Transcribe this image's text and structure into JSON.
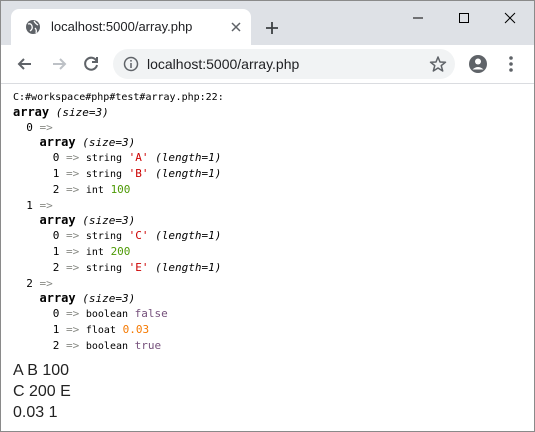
{
  "browser": {
    "tab_title": "localhost:5000/array.php",
    "url": "localhost:5000/array.php"
  },
  "dump": {
    "path": "C:#workspace#php#test#array.php:22:",
    "root_label": "array",
    "root_size": "(size=3)",
    "entries": [
      {
        "key": "0",
        "label": "array",
        "size": "(size=3)",
        "items": [
          {
            "key": "0",
            "type": "string",
            "value": "'A'",
            "extra": "(length=1)"
          },
          {
            "key": "1",
            "type": "string",
            "value": "'B'",
            "extra": "(length=1)"
          },
          {
            "key": "2",
            "type": "int",
            "value": "100",
            "extra": ""
          }
        ]
      },
      {
        "key": "1",
        "label": "array",
        "size": "(size=3)",
        "items": [
          {
            "key": "0",
            "type": "string",
            "value": "'C'",
            "extra": "(length=1)"
          },
          {
            "key": "1",
            "type": "int",
            "value": "200",
            "extra": ""
          },
          {
            "key": "2",
            "type": "string",
            "value": "'E'",
            "extra": "(length=1)"
          }
        ]
      },
      {
        "key": "2",
        "label": "array",
        "size": "(size=3)",
        "items": [
          {
            "key": "0",
            "type": "boolean",
            "value": "false",
            "extra": ""
          },
          {
            "key": "1",
            "type": "float",
            "value": "0.03",
            "extra": ""
          },
          {
            "key": "2",
            "type": "boolean",
            "value": "true",
            "extra": ""
          }
        ]
      }
    ]
  },
  "output_lines": [
    "A B 100",
    "C 200 E",
    "0.03 1"
  ],
  "colors": {
    "string": "#cc0000",
    "int": "#4e9a06",
    "boolean": "#75507b",
    "float": "#f57900",
    "arrow": "#888a85"
  },
  "icons": [
    "globe-icon",
    "close-icon",
    "plus-icon",
    "minimize-icon",
    "maximize-icon",
    "close-window-icon",
    "back-arrow-icon",
    "forward-arrow-icon",
    "reload-icon",
    "info-icon",
    "star-icon",
    "profile-icon",
    "menu-dots-icon"
  ]
}
